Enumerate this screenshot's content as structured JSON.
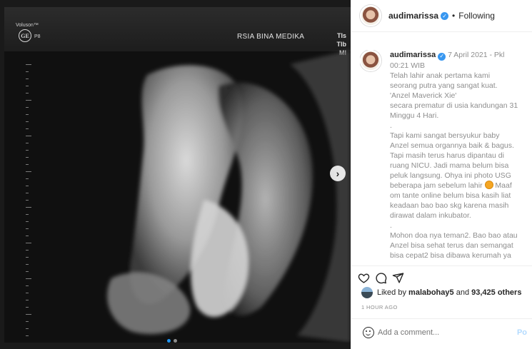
{
  "photo": {
    "brand": "Voluson™",
    "logo": "GE",
    "probe": "P8",
    "hospital": "RSIA BINA MEDIKA",
    "tis_lines": [
      "TIs",
      "TIb",
      "MI"
    ]
  },
  "header": {
    "username": "audimarissa",
    "separator": "•",
    "follow_status": "Following"
  },
  "caption": {
    "username": "audimarissa",
    "date": "7 April 2021 - Pkl",
    "lines": [
      "00:21 WIB",
      "Telah lahir anak pertama kami",
      "seorang putra yang sangat kuat.",
      "'Anzel Maverick Xie'",
      "secara prematur di usia kandungan 31",
      "Minggu 4 Hari.",
      ".",
      "Tapi kami sangat bersyukur baby",
      "Anzel semua organnya baik & bagus.",
      "Tapi masih terus harus dipantau di",
      "ruang NICU. Jadi mama belum bisa",
      "peluk langsung. Ohya ini photo USG",
      "beberapa jam sebelum lahir",
      "om tante online belum bisa kasih liat",
      "keadaan bao bao skg karena masih",
      "dirawat dalam inkubator.",
      ".",
      "Mohon doa nya teman2. Bao bao atau",
      "Anzel bisa sehat terus dan semangat",
      "bisa cepat2 bisa dibawa kerumah ya"
    ],
    "emoji_suffix": "Maaf"
  },
  "likes": {
    "prefix": "Liked by",
    "user": "malabohay5",
    "conjunction": "and",
    "count": "93,425 others"
  },
  "time_ago": "1 HOUR AGO",
  "comment": {
    "placeholder": "Add a comment...",
    "post_label": "Po"
  },
  "icons": {
    "like": "heart-icon",
    "comment": "comment-icon",
    "share": "share-icon",
    "next": "chevron-right-icon",
    "emoji": "smiley-icon"
  },
  "colors": {
    "text": "#262626",
    "muted": "#8e8e8e",
    "link_blue": "#3897f0",
    "post_disabled": "#b3dbff"
  }
}
